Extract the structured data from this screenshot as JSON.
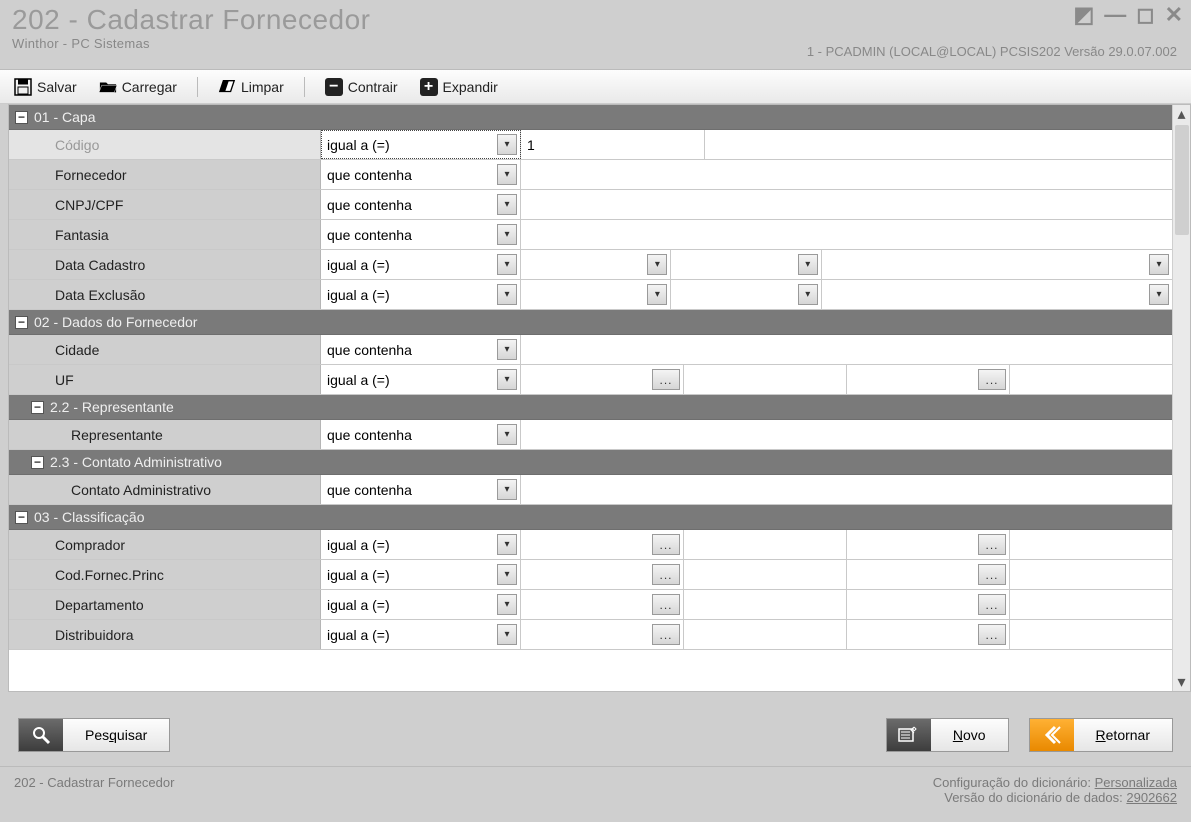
{
  "title": "202 - Cadastrar  Fornecedor",
  "subtitle": "Winthor - PC Sistemas",
  "session": "1 - PCADMIN (LOCAL@LOCAL)   PCSIS202  Versão  29.0.07.002",
  "toolbar": {
    "salvar": "Salvar",
    "carregar": "Carregar",
    "limpar": "Limpar",
    "contrair": "Contrair",
    "expandir": "Expandir"
  },
  "op": {
    "igual": "igual a (=)",
    "contenha": "que contenha"
  },
  "sections": {
    "s01": {
      "title": "01 - Capa"
    },
    "s02": {
      "title": "02 - Dados do Fornecedor"
    },
    "s22": {
      "title": "2.2 - Representante"
    },
    "s23": {
      "title": "2.3 - Contato Administrativo"
    },
    "s03": {
      "title": "03 - Classificação"
    }
  },
  "rows": {
    "codigo": {
      "label": "Código",
      "value": "1"
    },
    "fornecedor": {
      "label": "Fornecedor"
    },
    "cnpj": {
      "label": "CNPJ/CPF"
    },
    "fantasia": {
      "label": "Fantasia"
    },
    "dataCadastro": {
      "label": "Data Cadastro"
    },
    "dataExclusao": {
      "label": "Data Exclusão"
    },
    "cidade": {
      "label": "Cidade"
    },
    "uf": {
      "label": "UF"
    },
    "representante": {
      "label": "Representante"
    },
    "contatoAdm": {
      "label": "Contato Administrativo"
    },
    "comprador": {
      "label": "Comprador"
    },
    "codFornec": {
      "label": "Cod.Fornec.Princ"
    },
    "departamento": {
      "label": "Departamento"
    },
    "distribuidora": {
      "label": "Distribuidora"
    }
  },
  "buttons": {
    "pesquisar": "Pesquisar",
    "novo": "Novo",
    "retornar": "Retornar"
  },
  "status": {
    "left": "202 - Cadastrar  Fornecedor",
    "cfg_label": "Configuração do dicionário:",
    "cfg_value": "Personalizada",
    "ver_label": "Versão do dicionário de dados:",
    "ver_value": "2902662"
  }
}
